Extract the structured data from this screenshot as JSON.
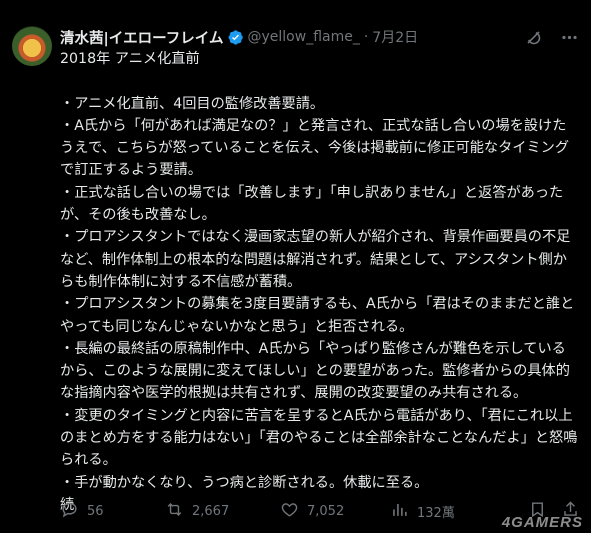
{
  "post": {
    "author_name": "清水茜|イエローフレイム",
    "handle": "@yellow_flame_",
    "separator": "·",
    "date": "7月2日",
    "body_lines": [
      "2018年 アニメ化直前",
      "",
      "・アニメ化直前、4回目の監修改善要請。",
      "・A氏から「何があれば満足なの？」と発言され、正式な話し合いの場を設けたうえで、こちらが怒っていることを伝え、今後は掲載前に修正可能なタイミングで訂正するよう要請。",
      "・正式な話し合いの場では「改善します」「申し訳ありません」と返答があったが、その後も改善なし。",
      "・プロアシスタントではなく漫画家志望の新人が紹介され、背景作画要員の不足など、制作体制上の根本的な問題は解消されず。結果として、アシスタント側からも制作体制に対する不信感が蓄積。",
      "・プロアシスタントの募集を3度目要請するも、A氏から「君はそのままだと誰とやっても同じなんじゃないかなと思う」と拒否される。",
      "・長編の最終話の原稿制作中、A氏から「やっぱり監修さんが難色を示しているから、このような展開に変えてほしい」との要望があった。監修者からの具体的な指摘内容や医学的根拠は共有されず、展開の改変要望のみ共有される。",
      "・変更のタイミングと内容に苦言を呈するとA氏から電話があり、「君にこれ以上のまとめ方をする能力はない」「君のやることは全部余計なことなんだよ」と怒鳴られる。",
      "・手が動かなくなり、うつ病と診断される。休載に至る。",
      "続"
    ]
  },
  "actions": {
    "replies": "56",
    "reposts": "2,667",
    "likes": "7,052",
    "views": "132萬"
  },
  "icons": {
    "verified": "verified-badge-icon",
    "grok": "grok-icon",
    "more": "more-icon",
    "reply": "reply-icon",
    "repost": "repost-icon",
    "like": "heart-icon",
    "views": "views-icon",
    "bookmark": "bookmark-icon",
    "share": "share-icon"
  },
  "colors": {
    "background": "#000000",
    "text": "#e7e9ea",
    "muted": "#71767b",
    "verified": "#1d9bf0"
  },
  "watermark": "4GAMERS"
}
